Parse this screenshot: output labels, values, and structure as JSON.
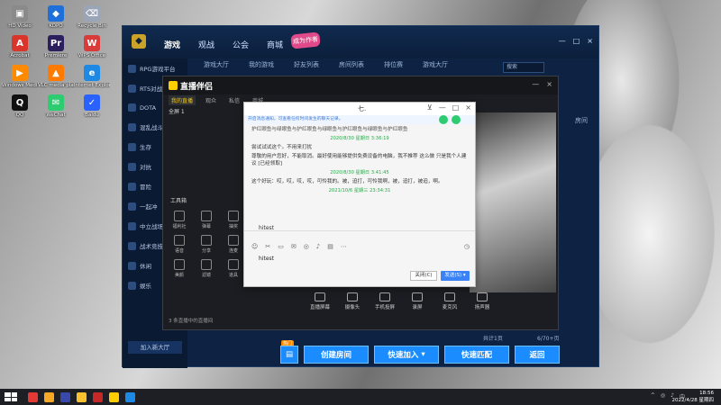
{
  "desktop": {
    "icons": [
      {
        "label": "HD Video",
        "color": "#8a8a8a",
        "glyph": "▣"
      },
      {
        "label": "KOPO",
        "color": "#1e6fd9",
        "glyph": "◆"
      },
      {
        "label": "Recycle Bin",
        "color": "#9aa6b8",
        "glyph": "⌫"
      },
      {
        "label": "Acrobat",
        "color": "#d9352a",
        "glyph": "A"
      },
      {
        "label": "Premiere",
        "color": "#2b1f5e",
        "glyph": "Pr"
      },
      {
        "label": "WPS Office",
        "color": "#d93a3a",
        "glyph": "W"
      },
      {
        "label": "Windows Media Player",
        "color": "#ff8a00",
        "glyph": "▶"
      },
      {
        "label": "VLC media player",
        "color": "#ff7a00",
        "glyph": "▲"
      },
      {
        "label": "Internet Explorer",
        "color": "#1e88e5",
        "glyph": "e"
      },
      {
        "label": "QQ",
        "color": "#111111",
        "glyph": "Q"
      },
      {
        "label": "WeChat",
        "color": "#2ecc71",
        "glyph": "✉"
      },
      {
        "label": "Baidu",
        "color": "#2962ff",
        "glyph": "✓"
      }
    ]
  },
  "game": {
    "logo": "◆",
    "nav": [
      "游戏",
      "观战",
      "公会",
      "商城"
    ],
    "badge": "成为作者",
    "subnav": [
      "游戏大厅",
      "我的游戏",
      "好友列表",
      "房间列表",
      "排位赛",
      "游戏大厅"
    ],
    "sidebar": [
      "RPG游戏平台",
      "RTS对战",
      "DOTA",
      "混乱战斗",
      "生存",
      "对抗",
      "冒险",
      "一起冲",
      "中立战场",
      "战术竞技",
      "休闲",
      "娱乐"
    ],
    "join_button": "加入新大厅",
    "search_placeholder": "搜索",
    "room_label": "房间",
    "bottom_buttons": [
      "创建房间",
      "快速加入",
      "快速匹配",
      "返回"
    ],
    "hot_tag": "热门",
    "page_counter": "6/70+页",
    "scroll_status": "共计1页"
  },
  "live": {
    "title": "直播伴侣",
    "tabs": [
      "我的直播",
      "观众",
      "私信",
      "商城"
    ],
    "scene": "全屏 1",
    "section_title": "工具箱",
    "tools": [
      "福利社",
      "弹幕",
      "抽奖",
      "语音",
      "分享",
      "连麦"
    ],
    "tools2": [
      "美颜",
      "滤镜",
      "道具"
    ],
    "status": "3 条直播中的直播间",
    "bottom_items": [
      "直播屏幕",
      "摄像头",
      "手机投屏",
      "录屏",
      "麦克风",
      "扬声器"
    ]
  },
  "chat": {
    "title": "七.",
    "notice": "开启消息通知，可查看任何时间发生的聊天记录。",
    "messages": [
      {
        "text": "护红眼鱼与绿眼鱼与护红眼鱼与绿眼鱼与护红眼鱼与绿眼鱼与护红眼鱼",
        "first": true
      },
      {
        "time": "2020/8/30 星期日 3:36:19"
      },
      {
        "text": "尝试试试这个。不用来打扰"
      },
      {
        "text": "尊敬的用户您好，不能取消。最好使用能够提供免费设备的电脑，我不推荐 这么做 只是我个人建议 [已经领取]"
      },
      {
        "time": "2020/8/30 星期日 3:41:45"
      },
      {
        "text": "这个好玩：哎，哎，哎，哎，可怜我的。被，迫打，可怜我啊，被，迫打，被迫，啊。"
      },
      {
        "time": "2021/10/6 星期三 23:34:31"
      }
    ],
    "preview": "hitest",
    "input": "hitest",
    "close_label": "关闭(C)",
    "send_label": "发送(S) ▾",
    "toolbar_icons": [
      "☺",
      "✂",
      "▭",
      "✉",
      "◎",
      "♪",
      "▤",
      "⋯"
    ],
    "clock_icon": "◷"
  },
  "taskbar": {
    "apps": [
      {
        "name": "chrome",
        "color": "#e53935"
      },
      {
        "name": "explorer",
        "color": "#f9a825"
      },
      {
        "name": "store",
        "color": "#3949ab"
      },
      {
        "name": "folder",
        "color": "#fbc02d"
      },
      {
        "name": "game",
        "color": "#c62828"
      },
      {
        "name": "live",
        "color": "#ffce00"
      },
      {
        "name": "chat",
        "color": "#1e88e5"
      }
    ],
    "tray": [
      "^",
      "◎",
      "♪",
      "中"
    ],
    "time": "18:56",
    "date": "2022/4/28 星期四"
  }
}
